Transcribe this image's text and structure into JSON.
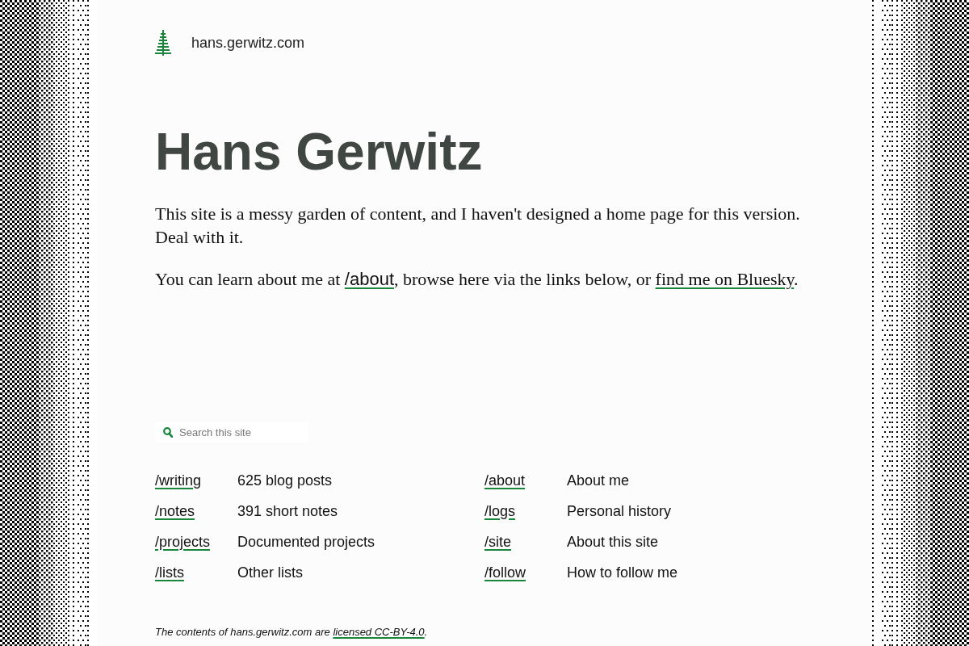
{
  "site": {
    "name": "hans.gerwitz.com"
  },
  "title": "Hans Gerwitz",
  "intro": [
    {
      "parts": [
        {
          "kind": "text",
          "text": "This site is a messy garden of content, and I haven't designed a home page for this version. Deal with it."
        }
      ]
    },
    {
      "parts": [
        {
          "kind": "text",
          "text": "You can learn about me at "
        },
        {
          "kind": "path_link",
          "text": "/about"
        },
        {
          "kind": "text",
          "text": ", browse here via the links below, or "
        },
        {
          "kind": "link",
          "text": "find me on Bluesky"
        },
        {
          "kind": "text",
          "text": "."
        }
      ]
    }
  ],
  "search": {
    "placeholder": "Search this site"
  },
  "nav": [
    {
      "links": [
        {
          "path": "/writing",
          "description": "625 blog posts"
        },
        {
          "path": "/notes",
          "description": "391 short notes"
        },
        {
          "path": "/projects",
          "description": "Documented projects"
        },
        {
          "path": "/lists",
          "description": "Other lists"
        }
      ]
    },
    {
      "links": [
        {
          "path": "/about",
          "description": "About me"
        },
        {
          "path": "/logs",
          "description": "Personal history"
        },
        {
          "path": "/site",
          "description": "About this site"
        },
        {
          "path": "/follow",
          "description": "How to follow me"
        }
      ]
    }
  ],
  "footer": {
    "parts": [
      {
        "kind": "text",
        "text": "The contents of hans.gerwitz.com are "
      },
      {
        "kind": "link",
        "text": "licensed CC-BY-4.0"
      },
      {
        "kind": "text",
        "text": "."
      }
    ]
  }
}
